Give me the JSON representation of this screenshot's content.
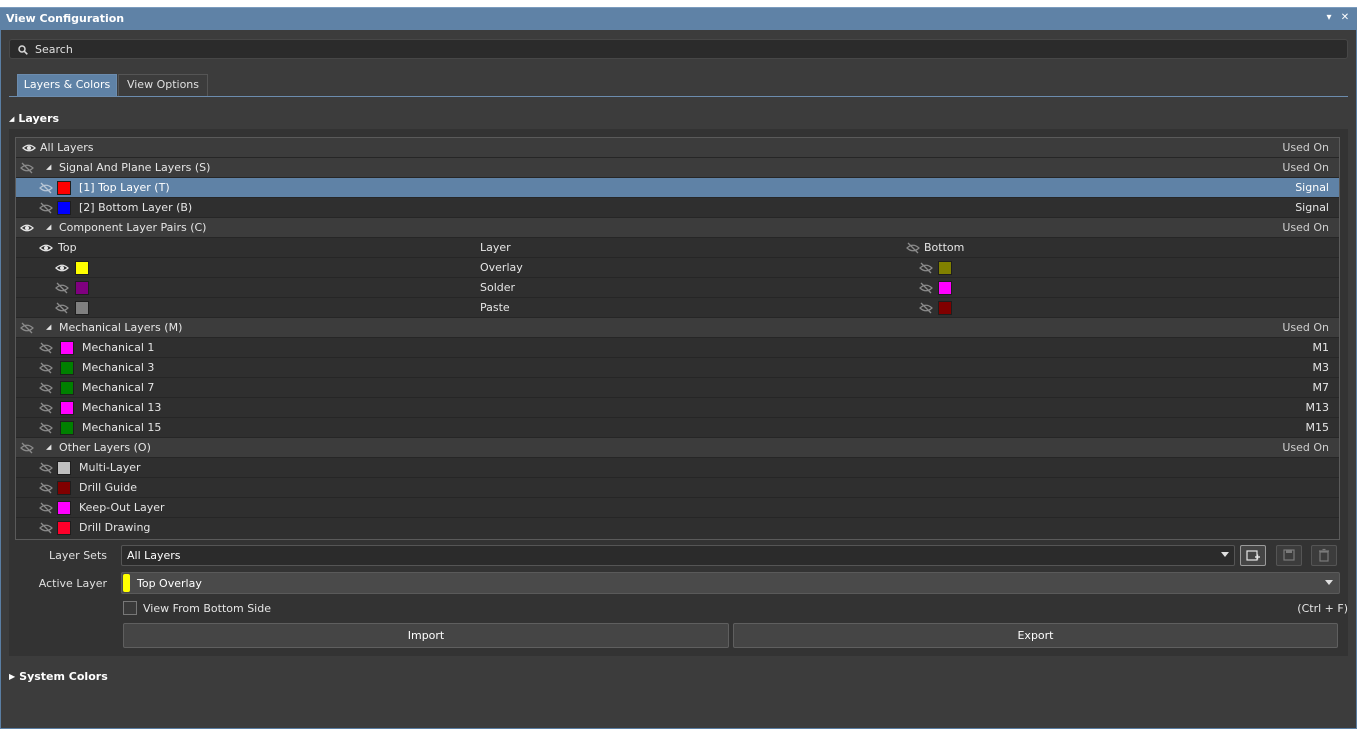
{
  "window": {
    "title": "View Configuration",
    "menu_icon": "dropdown-menu-icon",
    "close_icon": "close-icon"
  },
  "search": {
    "placeholder": "Search",
    "value": ""
  },
  "tabs": [
    {
      "label": "Layers & Colors",
      "active": true
    },
    {
      "label": "View Options",
      "active": false
    }
  ],
  "layers_section": {
    "title": "Layers",
    "expanded": true
  },
  "grid": {
    "all_layers": {
      "label": "All Layers",
      "right": "Used On",
      "visible": true
    },
    "signal_group": {
      "label": "Signal And Plane Layers (S)",
      "right": "Used On",
      "items": [
        {
          "label": "[1] Top Layer (T)",
          "color": "#ff0000",
          "right": "Signal",
          "selected": true
        },
        {
          "label": "[2] Bottom Layer (B)",
          "color": "#0000ff",
          "right": "Signal",
          "selected": false
        }
      ]
    },
    "component_group": {
      "label": "Component Layer Pairs (C)",
      "right": "Used On",
      "header": {
        "top": "Top",
        "layer": "Layer",
        "bottom": "Bottom"
      },
      "pairs": [
        {
          "layer": "Overlay",
          "top_color": "#ffff00",
          "bottom_color": "#808000",
          "top_visible": true
        },
        {
          "layer": "Solder",
          "top_color": "#800080",
          "bottom_color": "#ff00ff",
          "top_visible": false
        },
        {
          "layer": "Paste",
          "top_color": "#808080",
          "bottom_color": "#800000",
          "top_visible": false
        }
      ]
    },
    "mechanical_group": {
      "label": "Mechanical Layers (M)",
      "right": "Used On",
      "items": [
        {
          "label": "Mechanical 1",
          "color": "#ff00ff",
          "right": "M1"
        },
        {
          "label": "Mechanical 3",
          "color": "#008000",
          "right": "M3"
        },
        {
          "label": "Mechanical 7",
          "color": "#008000",
          "right": "M7"
        },
        {
          "label": "Mechanical 13",
          "color": "#ff00ff",
          "right": "M13"
        },
        {
          "label": "Mechanical 15",
          "color": "#008000",
          "right": "M15"
        }
      ]
    },
    "other_group": {
      "label": "Other Layers (O)",
      "right": "Used On",
      "items": [
        {
          "label": "Multi-Layer",
          "color": "#c0c0c0"
        },
        {
          "label": "Drill Guide",
          "color": "#800000"
        },
        {
          "label": "Keep-Out Layer",
          "color": "#ff00ff"
        },
        {
          "label": "Drill Drawing",
          "color": "#ff002a"
        }
      ]
    }
  },
  "layer_sets": {
    "label": "Layer Sets",
    "value": "All Layers"
  },
  "active_layer": {
    "label": "Active Layer",
    "value": "Top Overlay",
    "color": "#ffff00"
  },
  "view_bottom": {
    "label": "View From Bottom Side",
    "shortcut": "(Ctrl + F)",
    "checked": false
  },
  "buttons": {
    "import": "Import",
    "export": "Export"
  },
  "system_colors": {
    "title": "System Colors",
    "expanded": false
  }
}
